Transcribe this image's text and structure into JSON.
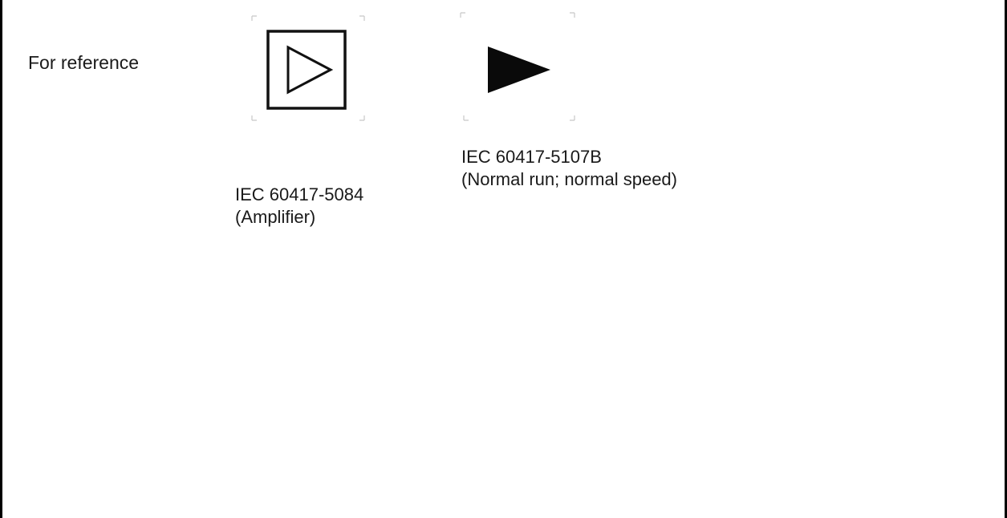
{
  "reference_label": "For reference",
  "symbols": [
    {
      "icon": "amplifier-symbol-icon",
      "code": "IEC 60417-5084",
      "description": "(Amplifier)"
    },
    {
      "icon": "normal-run-symbol-icon",
      "code": "IEC 60417-5107B",
      "description": "(Normal run; normal speed)"
    }
  ]
}
